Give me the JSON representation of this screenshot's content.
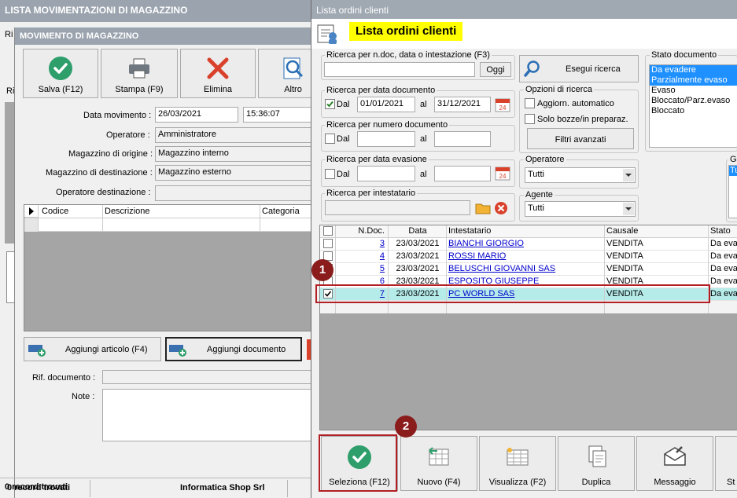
{
  "back_window": {
    "title": "LISTA MOVIMENTAZIONI DI MAGAZZINO",
    "edge_text_1": "Ri",
    "edge_text_2": "Ri"
  },
  "movement": {
    "title": "MOVIMENTO DI MAGAZZINO",
    "toolbar": {
      "save": "Salva (F12)",
      "print": "Stampa (F9)",
      "delete": "Elimina",
      "other": "Altro"
    },
    "labels": {
      "date": "Data movimento :",
      "operator": "Operatore :",
      "origin": "Magazzino di origine :",
      "destination": "Magazzino di destinazione :",
      "operator_dest": "Operatore destinazione :",
      "ref": "Rif. documento :",
      "notes": "Note :"
    },
    "values": {
      "date": "26/03/2021",
      "time": "15:36:07",
      "operator": "Amministratore",
      "origin": "Magazzino interno",
      "destination": "Magazzino esterno",
      "operator_dest": "",
      "ref": "",
      "notes": ""
    },
    "grid_headers": [
      "Codice",
      "Descrizione",
      "Categoria"
    ],
    "add_article": "Aggiungi articolo (F4)",
    "add_document": "Aggiungi documento",
    "status": {
      "records": "0 record trovati",
      "company": "Informatica Shop Srl"
    }
  },
  "orders": {
    "window_title": "Lista ordini clienti",
    "heading": "Lista ordini clienti",
    "search_doc": {
      "legend": "Ricerca per n.doc, data o intestazione (F3)",
      "value": "",
      "button": "Oggi"
    },
    "run_search": "Esegui ricerca",
    "search_date": {
      "legend": "Ricerca per data documento",
      "dal": "Dal",
      "al": "al",
      "from": "01/01/2021",
      "to": "31/12/2021"
    },
    "search_number": {
      "legend": "Ricerca per numero documento",
      "dal": "Dal",
      "al": "al"
    },
    "search_delivery": {
      "legend": "Ricerca per data evasione",
      "dal": "Dal",
      "al": "al"
    },
    "search_holder": {
      "legend": "Ricerca per intestatario"
    },
    "options": {
      "legend": "Opzioni di ricerca",
      "auto_update": "Aggiorn. automatico",
      "drafts_only": "Solo bozze/in preparaz.",
      "advanced": "Filtri avanzati"
    },
    "status_doc": {
      "legend": "Stato documento",
      "items": [
        "Da evadere",
        "Parzialmente evaso",
        "Evaso",
        "Bloccato/Parz.evaso",
        "Bloccato"
      ]
    },
    "operator": {
      "legend": "Operatore",
      "value": "Tutti"
    },
    "agent": {
      "legend": "Agente",
      "value": "Tutti"
    },
    "group": {
      "legend": "Gr",
      "value": "Tu"
    },
    "table": {
      "headers": [
        "N.Doc.",
        "Data",
        "Intestatario",
        "Causale",
        "Stato"
      ],
      "rows": [
        {
          "n": "3",
          "date": "23/03/2021",
          "holder": "BIANCHI GIORGIO",
          "cause": "VENDITA",
          "state": "Da eva"
        },
        {
          "n": "4",
          "date": "23/03/2021",
          "holder": "ROSSI MARIO",
          "cause": "VENDITA",
          "state": "Da eva"
        },
        {
          "n": "5",
          "date": "23/03/2021",
          "holder": "BELUSCHI GIOVANNI SAS",
          "cause": "VENDITA",
          "state": "Da eva"
        },
        {
          "n": "6",
          "date": "23/03/2021",
          "holder": "ESPOSITO GIUSEPPE",
          "cause": "VENDITA",
          "state": "Da eva"
        },
        {
          "n": "7",
          "date": "23/03/2021",
          "holder": "PC WORLD SAS",
          "cause": "VENDITA",
          "state": "Da eva"
        }
      ]
    },
    "bottom_buttons": {
      "select": "Seleziona (F12)",
      "new": "Nuovo (F4)",
      "view": "Visualizza (F2)",
      "duplicate": "Duplica",
      "message": "Messaggio",
      "st": "St"
    },
    "markers": {
      "one": "1",
      "two": "2"
    }
  },
  "colors": {
    "accent_green": "#2e9e6b",
    "delete_red": "#d9412b",
    "highlight_row": "#b5ebe9",
    "title_yellow": "#ffff00",
    "marker": "#8b1c1c",
    "selection_blue": "#1e90ff"
  }
}
